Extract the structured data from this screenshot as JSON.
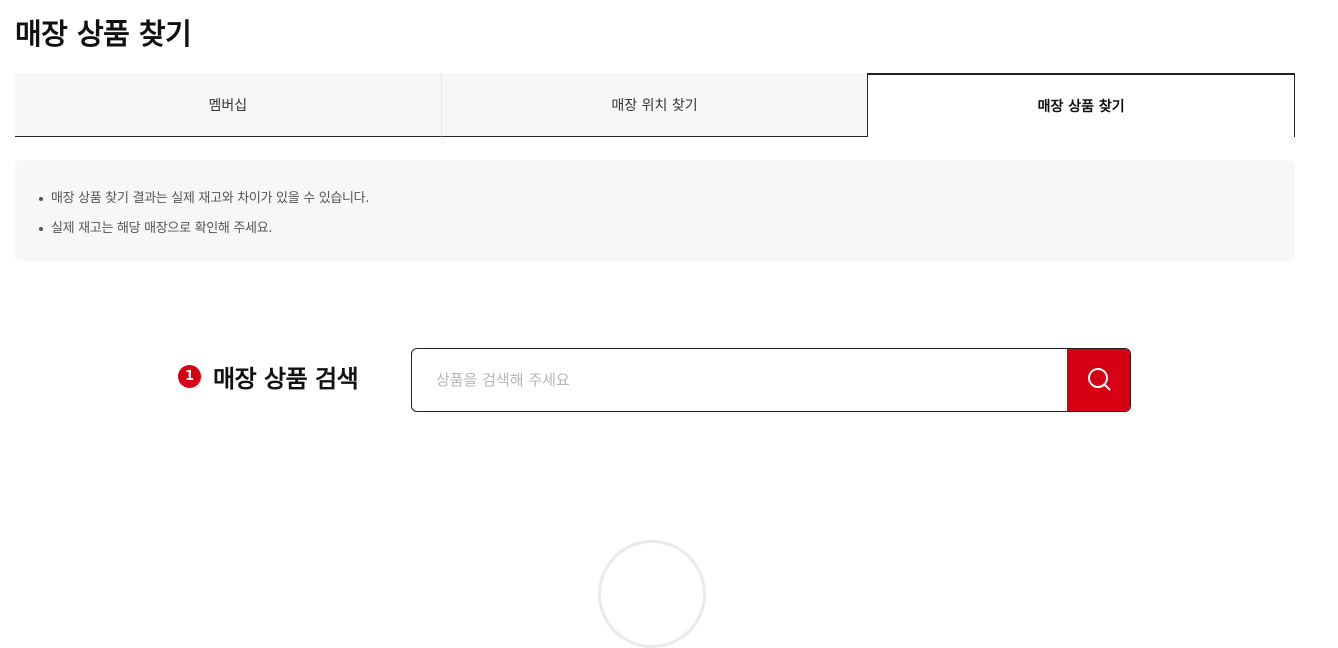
{
  "page": {
    "title": "매장 상품 찾기"
  },
  "tabs": [
    {
      "label": "멤버십",
      "active": false
    },
    {
      "label": "매장 위치 찾기",
      "active": false
    },
    {
      "label": "매장 상품 찾기",
      "active": true
    }
  ],
  "notice": {
    "items": [
      "매장 상품 찾기 결과는 실제 재고와 차이가 있을 수 있습니다.",
      "실제 재고는 해당 매장으로 확인해 주세요."
    ]
  },
  "search": {
    "step": "1",
    "title": "매장 상품 검색",
    "value": "",
    "placeholder": "상품을 검색해 주세요",
    "button_icon": "search-icon"
  },
  "colors": {
    "accent": "#d60012",
    "panel_bg": "#f6f7f9",
    "text": "#111111"
  }
}
